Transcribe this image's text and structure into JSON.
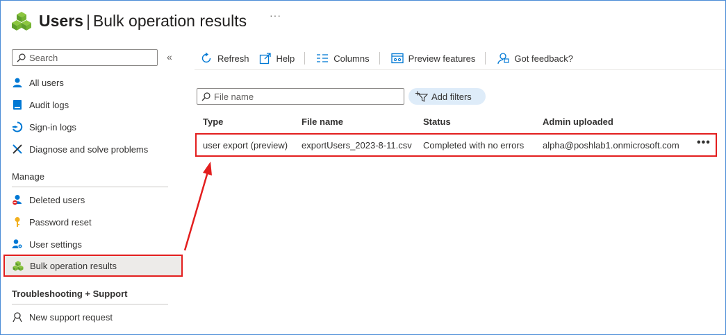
{
  "header": {
    "title_main": "Users",
    "title_separator": "|",
    "title_sub": "Bulk operation results",
    "more_label": "···"
  },
  "sidebar": {
    "search_placeholder": "Search",
    "collapse_label": "«",
    "top_items": [
      {
        "label": "All users",
        "icon": "user-icon"
      },
      {
        "label": "Audit logs",
        "icon": "audit-log-icon"
      },
      {
        "label": "Sign-in logs",
        "icon": "sign-in-icon"
      },
      {
        "label": "Diagnose and solve problems",
        "icon": "wrench-icon"
      }
    ],
    "manage_label": "Manage",
    "manage_items": [
      {
        "label": "Deleted users",
        "icon": "deleted-user-icon"
      },
      {
        "label": "Password reset",
        "icon": "key-icon"
      },
      {
        "label": "User settings",
        "icon": "user-settings-icon"
      },
      {
        "label": "Bulk operation results",
        "icon": "bulk-results-icon",
        "active": true
      }
    ],
    "troubleshoot_label": "Troubleshooting + Support",
    "support_items": [
      {
        "label": "New support request",
        "icon": "support-icon"
      }
    ]
  },
  "toolbar": {
    "refresh": "Refresh",
    "help": "Help",
    "columns": "Columns",
    "preview_features": "Preview features",
    "feedback": "Got feedback?"
  },
  "filters": {
    "file_name_placeholder": "File name",
    "add_filters": "Add filters"
  },
  "table": {
    "columns": [
      "Type",
      "File name",
      "Status",
      "Admin uploaded"
    ],
    "rows": [
      {
        "type": "user export (preview)",
        "file_name": "exportUsers_2023-8-11.csv",
        "status": "Completed with no errors",
        "admin": "alpha@poshlab1.onmicrosoft.com",
        "more": "•••"
      }
    ]
  },
  "colors": {
    "accent": "#0078d4",
    "highlight_red": "#e31e1e",
    "active_bg": "#edebe9",
    "filter_pill": "#deecf9"
  }
}
